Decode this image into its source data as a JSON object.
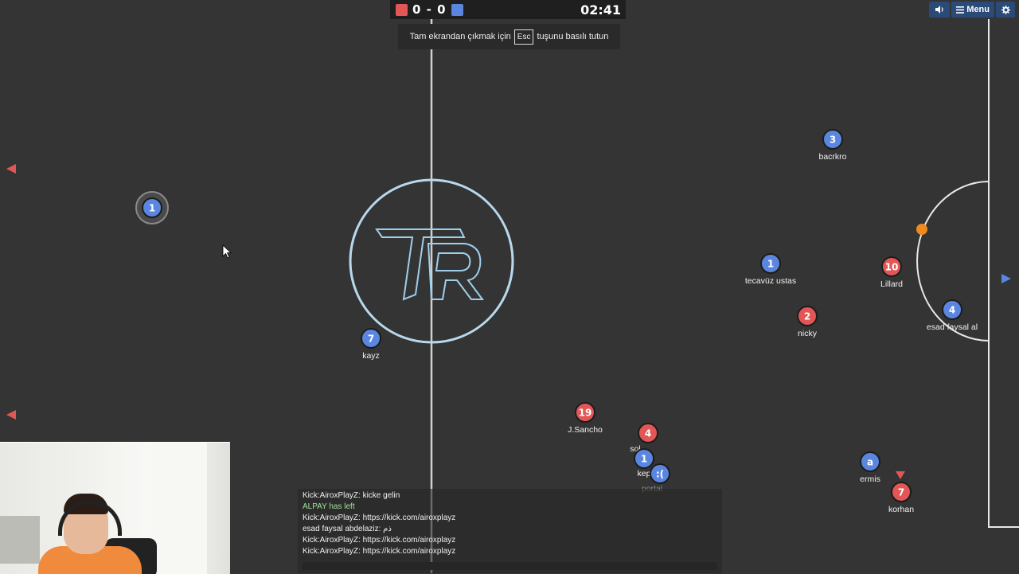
{
  "scoreboard": {
    "red_score": "0",
    "separator": "-",
    "blue_score": "0",
    "score_text": "0 - 0",
    "timer": "02:41",
    "red_color": "#e35656",
    "blue_color": "#5a86e0"
  },
  "fullscreen_hint": {
    "before": "Tam ekrandan çıkmak için",
    "key": "Esc",
    "after": "tuşunu basılı tutun"
  },
  "top_controls": {
    "sound_icon": "speaker-icon",
    "menu_label": "Menu",
    "settings_icon": "gear-icon"
  },
  "center_logo": "TR",
  "players": [
    {
      "team": "blue",
      "number": "1",
      "name": "",
      "highlighted": true
    },
    {
      "team": "blue",
      "number": "3",
      "name": "bacrkro"
    },
    {
      "team": "blue",
      "number": "1",
      "name": "tecavüz ustas"
    },
    {
      "team": "red",
      "number": "10",
      "name": "Lillard"
    },
    {
      "team": "red",
      "number": "2",
      "name": "nicky"
    },
    {
      "team": "blue",
      "number": "4",
      "name": "esad faysal al"
    },
    {
      "team": "blue",
      "number": "7",
      "name": "kayz"
    },
    {
      "team": "red",
      "number": "19",
      "name": "J.Sancho"
    },
    {
      "team": "red",
      "number": "4",
      "name": "sol"
    },
    {
      "team": "blue",
      "number": "1",
      "name": "kep"
    },
    {
      "team": "blue",
      "number": ":(",
      "name": "portal"
    },
    {
      "team": "blue",
      "number": "a",
      "name": "ermis"
    },
    {
      "team": "red",
      "number": "7",
      "name": "korhan"
    }
  ],
  "ball_color": "#f08a1c",
  "chat": {
    "lines": [
      {
        "text": "Kick:AiroxPlayZ: kicke gelin",
        "style": "normal"
      },
      {
        "text": "ALPAY has left",
        "style": "green"
      },
      {
        "text": "Kick:AiroxPlayZ: https://kick.com/airoxplayz",
        "style": "normal"
      },
      {
        "text": "esad faysal abdelaziz: ذم",
        "style": "normal"
      },
      {
        "text": "Kick:AiroxPlayZ: https://kick.com/airoxplayz",
        "style": "normal"
      },
      {
        "text": "Kick:AiroxPlayZ: https://kick.com/airoxplayz",
        "style": "normal"
      }
    ]
  }
}
